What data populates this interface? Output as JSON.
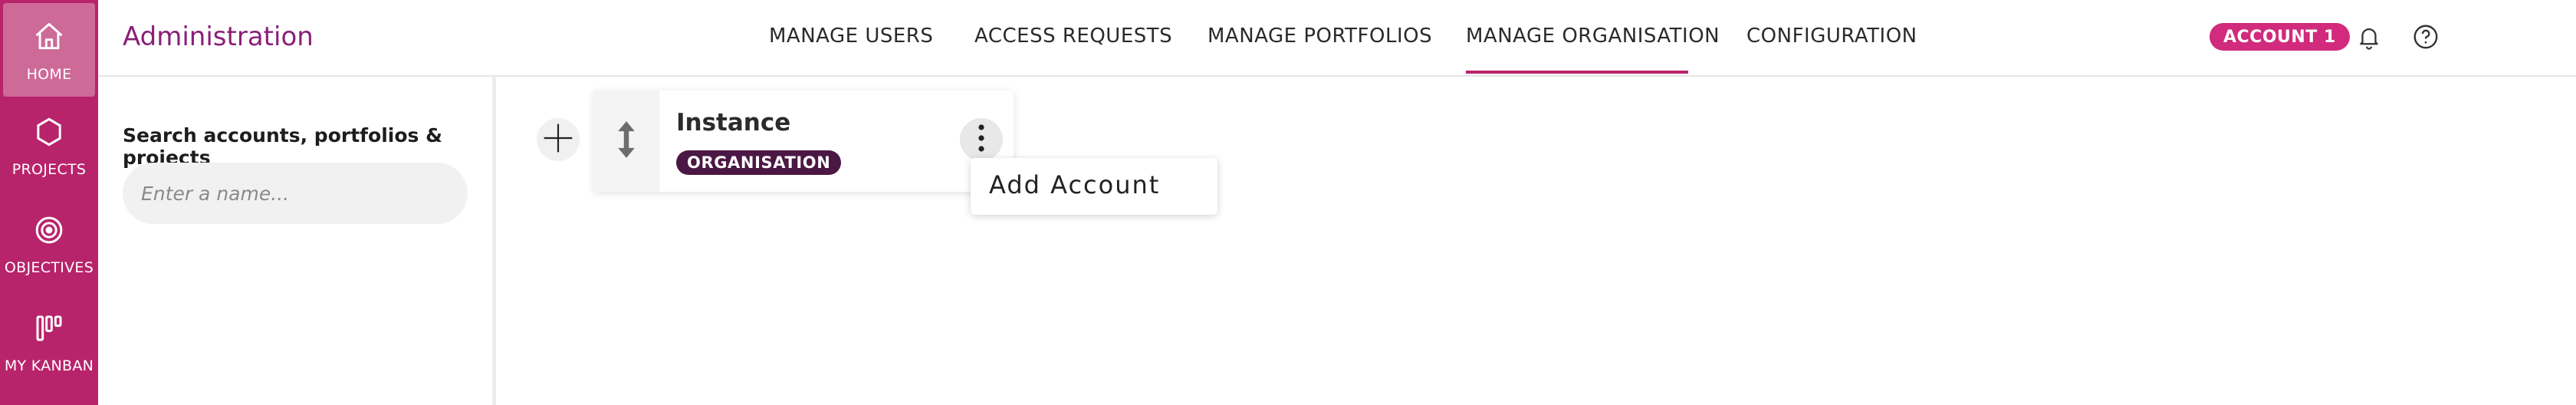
{
  "sidebar": {
    "items": [
      {
        "label": "HOME",
        "icon": "home-icon",
        "active": true
      },
      {
        "label": "PROJECTS",
        "icon": "hexagon-icon",
        "active": false
      },
      {
        "label": "OBJECTIVES",
        "icon": "target-icon",
        "active": false
      },
      {
        "label": "MY KANBAN",
        "icon": "kanban-icon",
        "active": false
      }
    ]
  },
  "header": {
    "title": "Administration",
    "tabs": [
      {
        "label": "MANAGE USERS",
        "active": false
      },
      {
        "label": "ACCESS REQUESTS",
        "active": false
      },
      {
        "label": "MANAGE PORTFOLIOS",
        "active": false
      },
      {
        "label": "MANAGE ORGANISATION",
        "active": true
      },
      {
        "label": "CONFIGURATION",
        "active": false
      }
    ],
    "account_badge": "ACCOUNT 1",
    "icons": [
      "bell-icon",
      "help-icon"
    ]
  },
  "search": {
    "heading": "Search accounts, portfolios & projects",
    "placeholder": "Enter a name..."
  },
  "tree": {
    "node": {
      "title": "Instance",
      "badge": "ORGANISATION"
    },
    "menu": {
      "items": [
        "Add Account"
      ]
    }
  },
  "colors": {
    "brand": "#b8246b",
    "title": "#8a1f78",
    "badge_dark": "#4b1744",
    "account_badge": "#d22a7c"
  }
}
